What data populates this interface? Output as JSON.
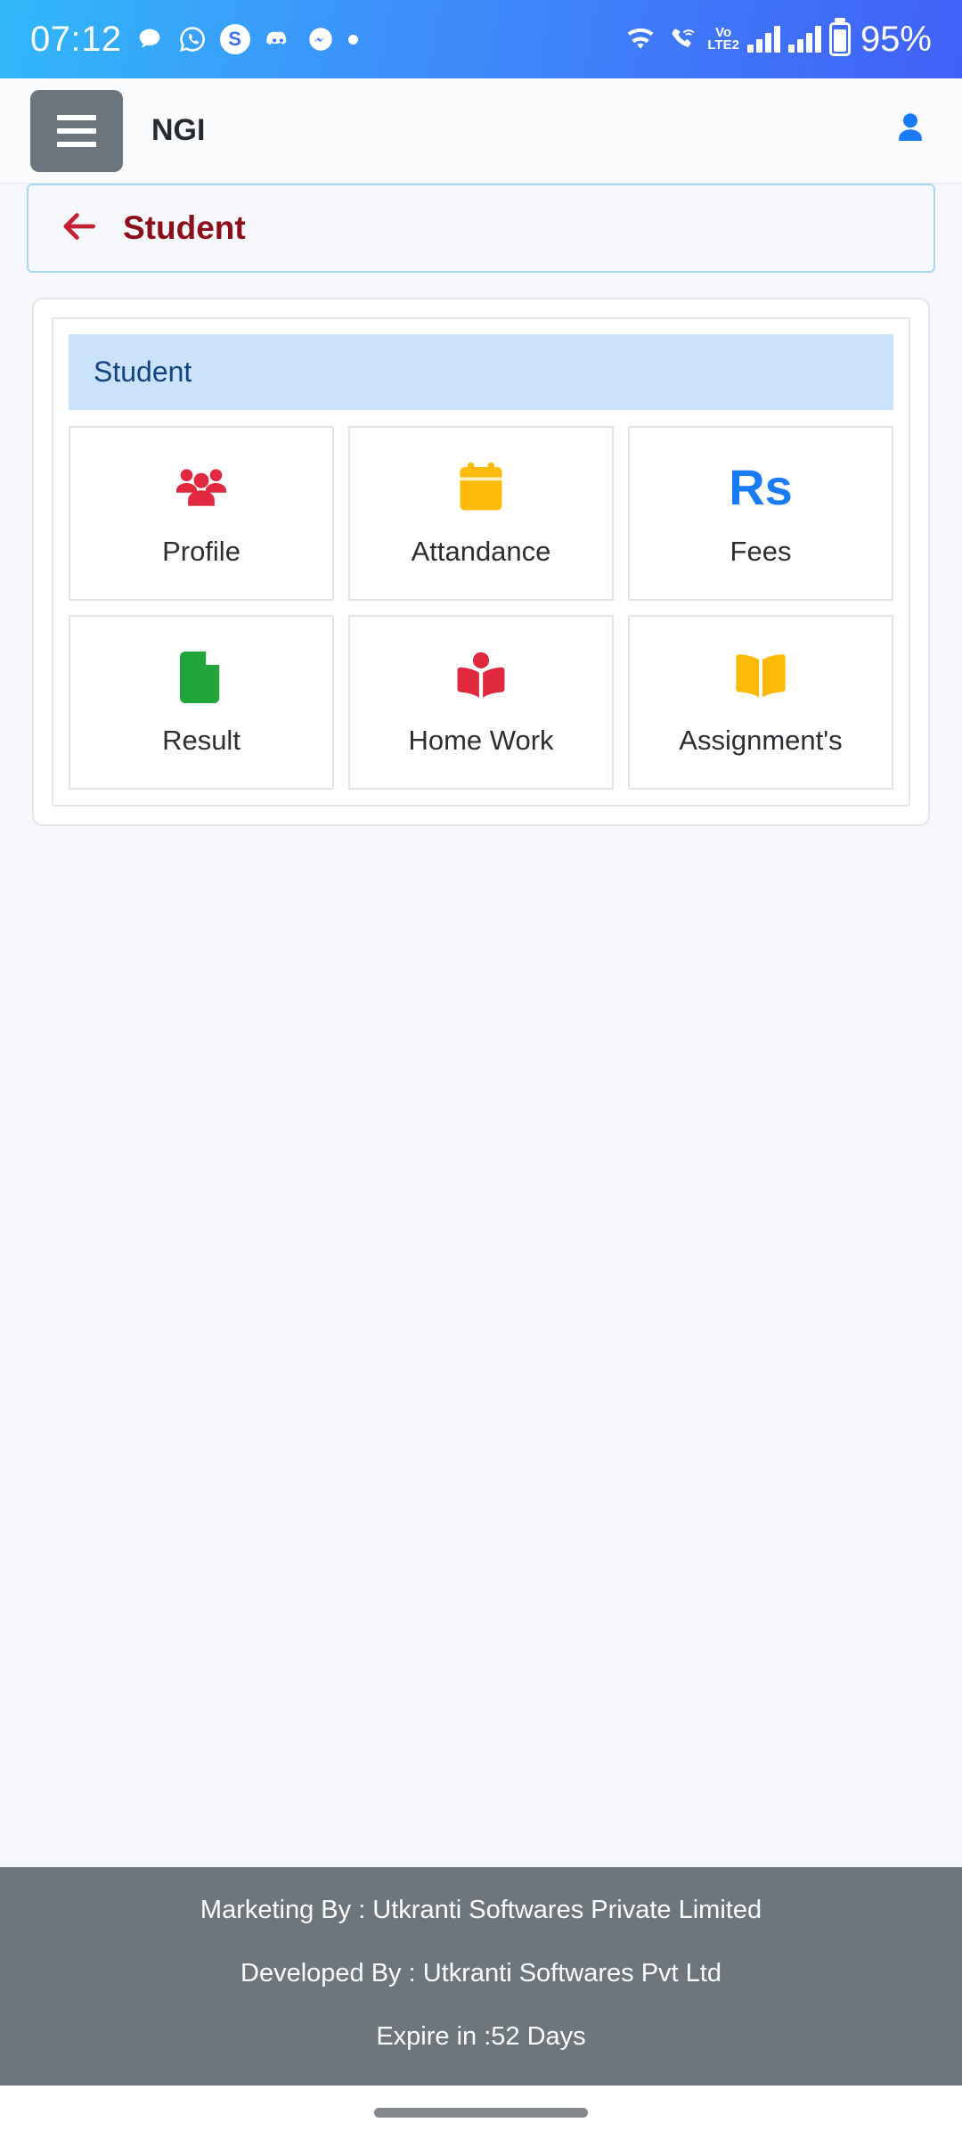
{
  "status_bar": {
    "time": "07:12",
    "battery_percent": "95%",
    "gradient_start": "#31b8fa",
    "gradient_end": "#4160f8",
    "left_icons": [
      "messages-icon",
      "whatsapp-icon",
      "skype-icon",
      "discord-icon",
      "messenger-icon",
      "more-dot-icon"
    ],
    "right_icons": [
      "wifi-icon",
      "call-wifi-icon",
      "volte-icon",
      "signal-bars-sim1-icon",
      "signal-bars-sim2-icon",
      "battery-icon"
    ],
    "volte_top": "Vo",
    "volte_bottom": "LTE2",
    "skype_letter": "S"
  },
  "app_bar": {
    "title": "NGI",
    "menu_icon": "hamburger-menu-icon",
    "profile_icon": "account-person-icon",
    "menu_bg": "#6b757d",
    "profile_color": "#1a7cf5"
  },
  "back_bar": {
    "title": "Student",
    "back_icon": "arrow-left-icon",
    "title_color": "#8b0f1a",
    "border_color": "#a9d9e5"
  },
  "content": {
    "section_title": "Student",
    "section_bg": "#cbe2fb",
    "section_text_color": "#11447f",
    "tiles": [
      {
        "label": "Profile",
        "icon": "people-group-icon",
        "color": "#e0293f"
      },
      {
        "label": "Attandance",
        "icon": "calendar-icon",
        "color": "#fcba0a"
      },
      {
        "label": "Fees",
        "icon": "rupee-icon",
        "color": "#1a7cf5",
        "glyph": "Rs"
      },
      {
        "label": "Result",
        "icon": "document-page-icon",
        "color": "#22a63c"
      },
      {
        "label": "Home Work",
        "icon": "reading-person-icon",
        "color": "#e0293f"
      },
      {
        "label": "Assignment's",
        "icon": "open-book-icon",
        "color": "#fcba0a"
      }
    ]
  },
  "footer": {
    "marketing_line": "Marketing By : Utkranti Softwares Private Limited",
    "developed_line": "Developed By : Utkranti Softwares Pvt Ltd",
    "expiry_line": "Expire in :52 Days",
    "bg": "#6d767d"
  },
  "gesture_bar": {
    "handle": "home-gesture-pill"
  }
}
